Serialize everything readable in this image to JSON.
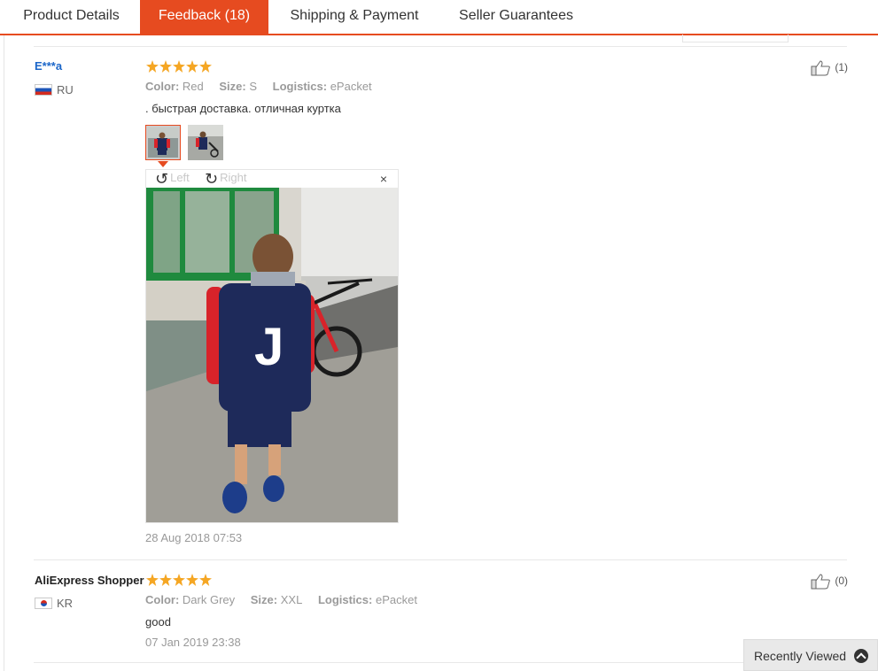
{
  "tabs": [
    {
      "label": "Product Details"
    },
    {
      "label": "Feedback (18)"
    },
    {
      "label": "Shipping & Payment"
    },
    {
      "label": "Seller Guarantees"
    }
  ],
  "reviews": [
    {
      "name": "E***a",
      "country": "RU",
      "rating": 5,
      "color_key": "Color:",
      "color": "Red",
      "size_key": "Size:",
      "size": "S",
      "logistics_key": "Logistics:",
      "logistics": "ePacket",
      "text": ". быстрая доставка. отличная куртка",
      "date": "28 Aug 2018 07:53",
      "likes": "(1)",
      "viewer": {
        "rotate_left": "Left",
        "rotate_right": "Right",
        "close": "×"
      }
    },
    {
      "name": "AliExpress Shopper",
      "country": "KR",
      "rating": 5,
      "color_key": "Color:",
      "color": "Dark Grey",
      "size_key": "Size:",
      "size": "XXL",
      "logistics_key": "Logistics:",
      "logistics": "ePacket",
      "text": "good",
      "date": "07 Jan 2019 23:38",
      "likes": "(0)"
    }
  ],
  "recently_viewed": {
    "label": "Recently Viewed"
  },
  "colors": {
    "accent": "#e64b20",
    "star": "#f5a623",
    "link": "#1b66c9"
  }
}
